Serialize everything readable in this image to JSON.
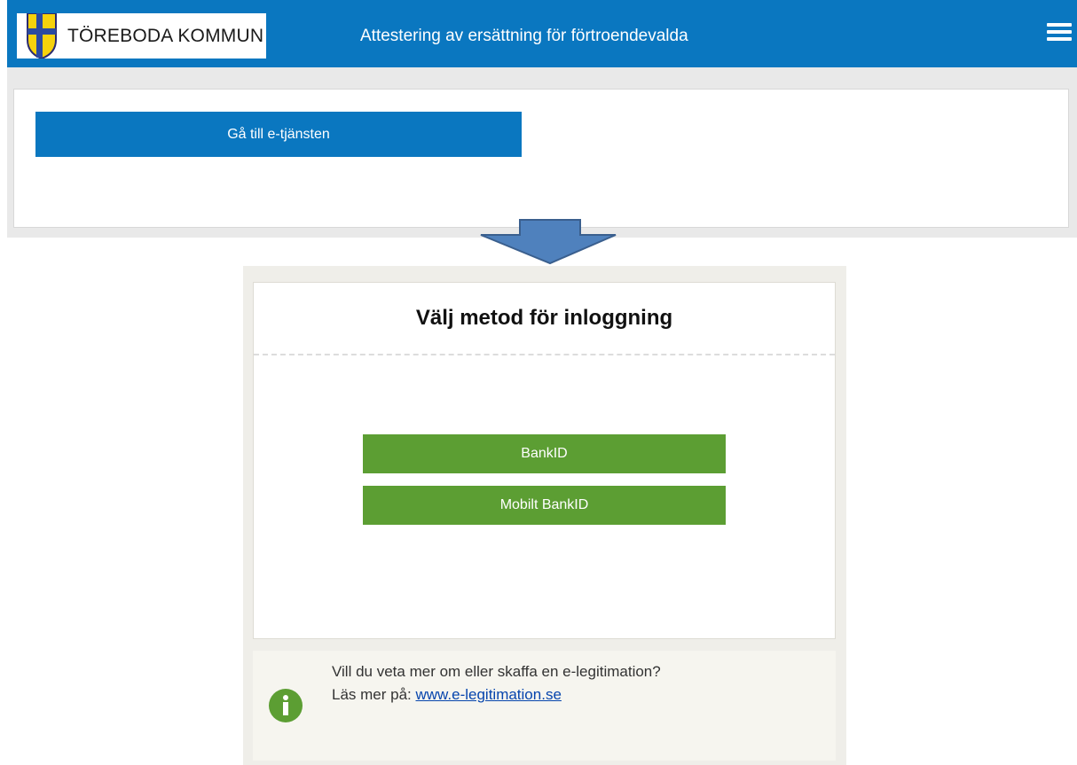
{
  "header": {
    "logo_text": "TÖREBODA KOMMUN",
    "title": "Attestering av ersättning för förtroendevalda",
    "menu_icon": "hamburger-menu-icon",
    "color": "#0a77c0"
  },
  "main": {
    "goto_button_label": "Gå till e-tjänsten"
  },
  "arrow_icon": "down-arrow-icon",
  "login": {
    "title": "Välj metod för inloggning",
    "methods": [
      {
        "label": "BankID"
      },
      {
        "label": "Mobilt BankID"
      }
    ],
    "button_color": "#5c9e33"
  },
  "info": {
    "icon": "info-icon",
    "line1": "Vill du veta mer om eller skaffa en e-legitimation?",
    "line2_prefix": "Läs mer på: ",
    "link_text": "www.e-legitimation.se"
  }
}
